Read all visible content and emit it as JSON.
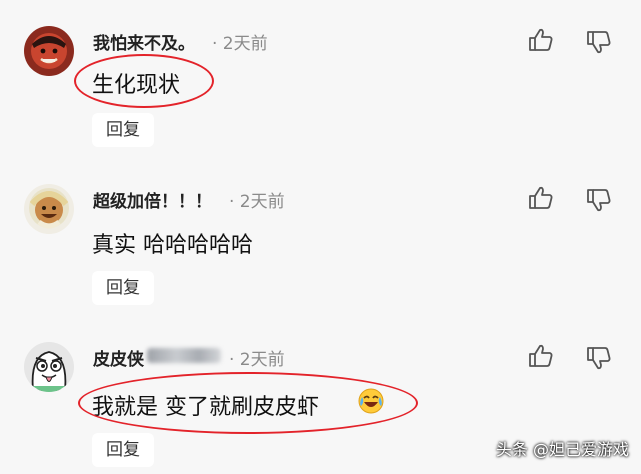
{
  "comments": [
    {
      "username": "我怕来不及。",
      "meta": "· 2天前",
      "text": "生化现状",
      "reply": "回复",
      "avatar": "user-avatar-icon",
      "like_icon": "thumbs-up-icon",
      "dislike_icon": "thumbs-down-icon"
    },
    {
      "username": "超级加倍！！！",
      "meta": "· 2天前",
      "text": "真实  哈哈哈哈哈",
      "reply": "回复",
      "avatar": "user-avatar-icon",
      "like_icon": "thumbs-up-icon",
      "dislike_icon": "thumbs-down-icon"
    },
    {
      "username": "皮皮侠",
      "meta": "· 2天前",
      "text": "我就是  变了就刷皮皮虾",
      "reply": "回复",
      "avatar": "user-avatar-icon",
      "like_icon": "thumbs-up-icon",
      "dislike_icon": "thumbs-down-icon",
      "emoji": "laughing-crying-emoji"
    }
  ],
  "watermark": "头条 @妲己爱游戏",
  "colors": {
    "background": "#f7f7f7",
    "annotation": "#e3232a",
    "meta": "#8a8a8a"
  }
}
